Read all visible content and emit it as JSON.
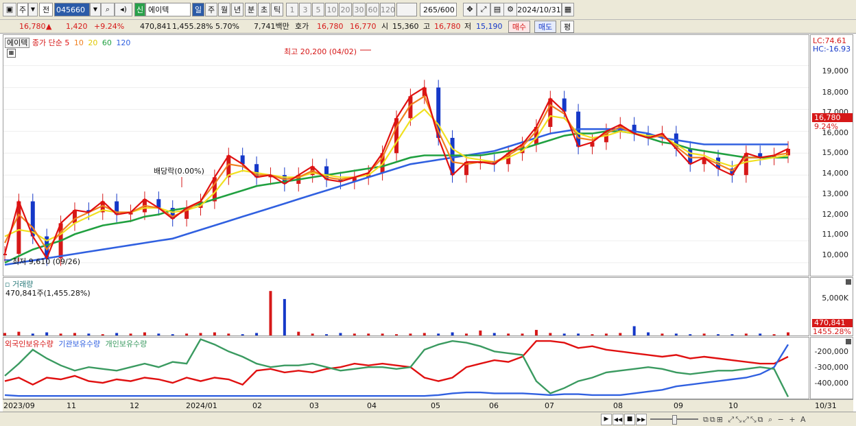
{
  "toolbar": {
    "market": "주",
    "period_type": "전",
    "code": "045660",
    "stock_name": "에이텍",
    "credit_badge": "신",
    "periods": [
      "일",
      "주",
      "월",
      "년",
      "분",
      "초",
      "틱"
    ],
    "minutes": [
      "1",
      "3",
      "5",
      "10",
      "20",
      "30",
      "60",
      "120"
    ],
    "count": "265",
    "total": "/600",
    "date": "2024/10/31"
  },
  "info": {
    "price": "16,780",
    "arrow": "▲",
    "change": "1,420",
    "change_pct": "+9.24%",
    "volume": "470,841",
    "volume_pct": "1,455.28%",
    "turnover": "5.70%",
    "amount": "7,741백만",
    "bid_label": "호가",
    "bid1": "16,780",
    "bid2": "16,770",
    "open_label": "시",
    "open": "15,360",
    "high_label": "고",
    "high": "16,780",
    "low_label": "저",
    "low": "15,190",
    "buy": "매수",
    "sell": "매도",
    "eval": "평"
  },
  "price_panel": {
    "stock_tag": "에이텍",
    "ma_label": "종가 단순",
    "ma_periods": [
      "5",
      "10",
      "20",
      "60",
      "120"
    ],
    "max_label": "최고 20,200 (04/02)",
    "min_label": "최저 9,610 (09/26)",
    "dividend_label": "배당락(0.00%)",
    "lc": "LC:74.61",
    "hc": "HC:-16.93",
    "yticks": [
      "19,000",
      "18,000",
      "17,000",
      "16,000",
      "15,000",
      "14,000",
      "13,000",
      "12,000",
      "11,000",
      "10,000"
    ],
    "current_price": "16,780",
    "current_pct": "9.24%"
  },
  "volume_panel": {
    "title": "거래량",
    "value": "470,841주(1,455.28%)",
    "ytick": "5,000K",
    "current": "470,841",
    "current_pct": "1455.28%"
  },
  "holding_panel": {
    "legend": [
      "외국인보유수량",
      "기관보유수량",
      "개인보유수량"
    ],
    "yticks": [
      "-200,000",
      "-300,000",
      "-400,000"
    ]
  },
  "xaxis": {
    "labels": [
      "2023/09",
      "11",
      "12",
      "2024/01",
      "02",
      "03",
      "04",
      "05",
      "06",
      "07",
      "08",
      "09",
      "10"
    ],
    "right_label": "10/31"
  },
  "colors": {
    "up": "#d61818",
    "down": "#1538c8",
    "ma5": "#e01010",
    "ma10": "#f08020",
    "ma20": "#f0e020",
    "ma60": "#20a040",
    "ma120": "#3060e0",
    "foreign": "#e01010",
    "inst": "#3060e0",
    "indiv": "#3a9a60"
  },
  "chart_data": {
    "type": "line",
    "series": [
      {
        "name": "5",
        "values": [
          10.4,
          12.8,
          11.2,
          10.2,
          11.8,
          12.4,
          12.3,
          12.8,
          12.2,
          12.3,
          12.9,
          12.5,
          12.0,
          12.5,
          12.8,
          13.9,
          14.9,
          14.5,
          13.9,
          14.0,
          13.6,
          14.0,
          14.4,
          13.8,
          13.7,
          13.9,
          14.1,
          15.0,
          16.6,
          17.6,
          18.0,
          15.7,
          14.0,
          14.6,
          14.6,
          14.5,
          15.0,
          15.4,
          16.2,
          17.5,
          16.9,
          15.3,
          15.5,
          16.0,
          16.3,
          15.9,
          15.7,
          15.9,
          15.2,
          14.5,
          14.8,
          14.3,
          14.0,
          15.0,
          14.8,
          14.9,
          15.2
        ]
      },
      {
        "name": "10",
        "values": [
          10.9,
          12.2,
          11.6,
          10.6,
          11.4,
          12.0,
          12.3,
          12.6,
          12.3,
          12.3,
          12.6,
          12.5,
          12.1,
          12.4,
          12.8,
          13.6,
          14.5,
          14.4,
          14.0,
          14.0,
          13.8,
          13.9,
          14.2,
          13.9,
          13.8,
          13.9,
          14.1,
          14.8,
          16.2,
          17.2,
          17.6,
          16.0,
          14.6,
          14.5,
          14.6,
          14.6,
          14.9,
          15.3,
          16.0,
          17.2,
          16.8,
          15.7,
          15.6,
          15.9,
          16.2,
          15.9,
          15.7,
          15.8,
          15.3,
          14.8,
          14.8,
          14.5,
          14.2,
          14.8,
          14.8,
          14.9,
          15.0
        ]
      },
      {
        "name": "20",
        "values": [
          11.2,
          11.5,
          11.4,
          11.0,
          11.3,
          11.8,
          12.1,
          12.4,
          12.3,
          12.3,
          12.5,
          12.5,
          12.3,
          12.4,
          12.6,
          13.2,
          14.0,
          14.2,
          14.1,
          14.0,
          13.9,
          13.9,
          14.1,
          14.0,
          13.9,
          13.9,
          14.0,
          14.5,
          15.5,
          16.5,
          17.0,
          16.3,
          15.2,
          14.8,
          14.7,
          14.6,
          14.8,
          15.1,
          15.7,
          16.7,
          16.6,
          15.9,
          15.7,
          15.8,
          16.0,
          15.9,
          15.8,
          15.8,
          15.4,
          15.0,
          14.9,
          14.6,
          14.4,
          14.6,
          14.7,
          14.8,
          14.9
        ]
      },
      {
        "name": "60",
        "values": [
          10.0,
          10.3,
          10.6,
          10.8,
          11.0,
          11.3,
          11.5,
          11.7,
          11.8,
          11.9,
          12.1,
          12.2,
          12.4,
          12.5,
          12.7,
          12.9,
          13.1,
          13.3,
          13.5,
          13.6,
          13.7,
          13.8,
          13.9,
          14.0,
          14.1,
          14.2,
          14.3,
          14.4,
          14.6,
          14.8,
          14.9,
          14.9,
          14.9,
          14.9,
          14.9,
          15.0,
          15.1,
          15.2,
          15.4,
          15.6,
          15.8,
          15.9,
          15.9,
          16.0,
          16.0,
          15.9,
          15.7,
          15.5,
          15.4,
          15.2,
          15.1,
          15.0,
          14.9,
          14.8,
          14.8,
          14.8,
          14.8
        ]
      },
      {
        "name": "120",
        "values": [
          9.9,
          10.0,
          10.1,
          10.2,
          10.3,
          10.4,
          10.5,
          10.6,
          10.7,
          10.8,
          10.9,
          11.0,
          11.1,
          11.3,
          11.5,
          11.7,
          11.9,
          12.1,
          12.3,
          12.5,
          12.7,
          12.9,
          13.1,
          13.3,
          13.5,
          13.7,
          13.9,
          14.1,
          14.3,
          14.5,
          14.6,
          14.7,
          14.8,
          14.9,
          15.0,
          15.1,
          15.3,
          15.5,
          15.7,
          15.9,
          16.0,
          16.1,
          16.1,
          16.1,
          16.1,
          16.0,
          15.9,
          15.7,
          15.6,
          15.5,
          15.4,
          15.4,
          15.4,
          15.4,
          15.4,
          15.4,
          15.4
        ]
      }
    ],
    "ylim": [
      9.4,
      20.4
    ],
    "unit_note": "thousand KRW",
    "volume": [
      0.4,
      0.6,
      0.3,
      0.5,
      0.3,
      0.4,
      0.3,
      0.2,
      0.4,
      0.3,
      0.5,
      0.3,
      0.2,
      0.3,
      0.4,
      0.5,
      0.3,
      0.2,
      0.4,
      7.2,
      5.9,
      0.6,
      0.3,
      0.2,
      0.4,
      0.3,
      0.3,
      0.3,
      0.2,
      0.3,
      0.4,
      0.3,
      0.5,
      0.3,
      0.8,
      0.4,
      0.3,
      0.3,
      0.9,
      0.4,
      0.3,
      0.3,
      0.2,
      0.3,
      0.4,
      1.5,
      0.5,
      0.3,
      0.3,
      0.2,
      0.3,
      0.2,
      0.2,
      0.3,
      0.3,
      0.2,
      0.5
    ],
    "foreign": [
      -400,
      -380,
      -420,
      -380,
      -390,
      -370,
      -400,
      -410,
      -390,
      -400,
      -380,
      -390,
      -410,
      -380,
      -400,
      -380,
      -390,
      -420,
      -340,
      -330,
      -350,
      -340,
      -350,
      -330,
      -320,
      -300,
      -310,
      -300,
      -310,
      -320,
      -380,
      -400,
      -380,
      -320,
      -300,
      -280,
      -290,
      -260,
      -170,
      -170,
      -180,
      -210,
      -200,
      -220,
      -230,
      -240,
      -250,
      -260,
      -250,
      -270,
      -260,
      -270,
      -280,
      -290,
      -300,
      -300,
      -260
    ],
    "inst": [
      -480,
      -485,
      -485,
      -485,
      -485,
      -485,
      -485,
      -485,
      -485,
      -485,
      -485,
      -485,
      -485,
      -485,
      -485,
      -485,
      -485,
      -485,
      -485,
      -485,
      -485,
      -485,
      -485,
      -485,
      -485,
      -485,
      -485,
      -485,
      -485,
      -485,
      -485,
      -480,
      -470,
      -465,
      -465,
      -470,
      -470,
      -470,
      -475,
      -480,
      -475,
      -475,
      -480,
      -480,
      -480,
      -470,
      -460,
      -450,
      -430,
      -420,
      -410,
      -400,
      -390,
      -380,
      -360,
      -320,
      -190
    ],
    "indiv": [
      -370,
      -300,
      -220,
      -270,
      -310,
      -340,
      -320,
      -330,
      -340,
      -320,
      -300,
      -320,
      -290,
      -300,
      -160,
      -190,
      -230,
      -260,
      -300,
      -320,
      -310,
      -310,
      -300,
      -320,
      -340,
      -330,
      -320,
      -320,
      -330,
      -320,
      -220,
      -190,
      -170,
      -180,
      -200,
      -230,
      -240,
      -250,
      -400,
      -470,
      -440,
      -400,
      -380,
      -350,
      -340,
      -330,
      -320,
      -330,
      -350,
      -360,
      -350,
      -340,
      -340,
      -330,
      -320,
      -330,
      -490
    ]
  }
}
